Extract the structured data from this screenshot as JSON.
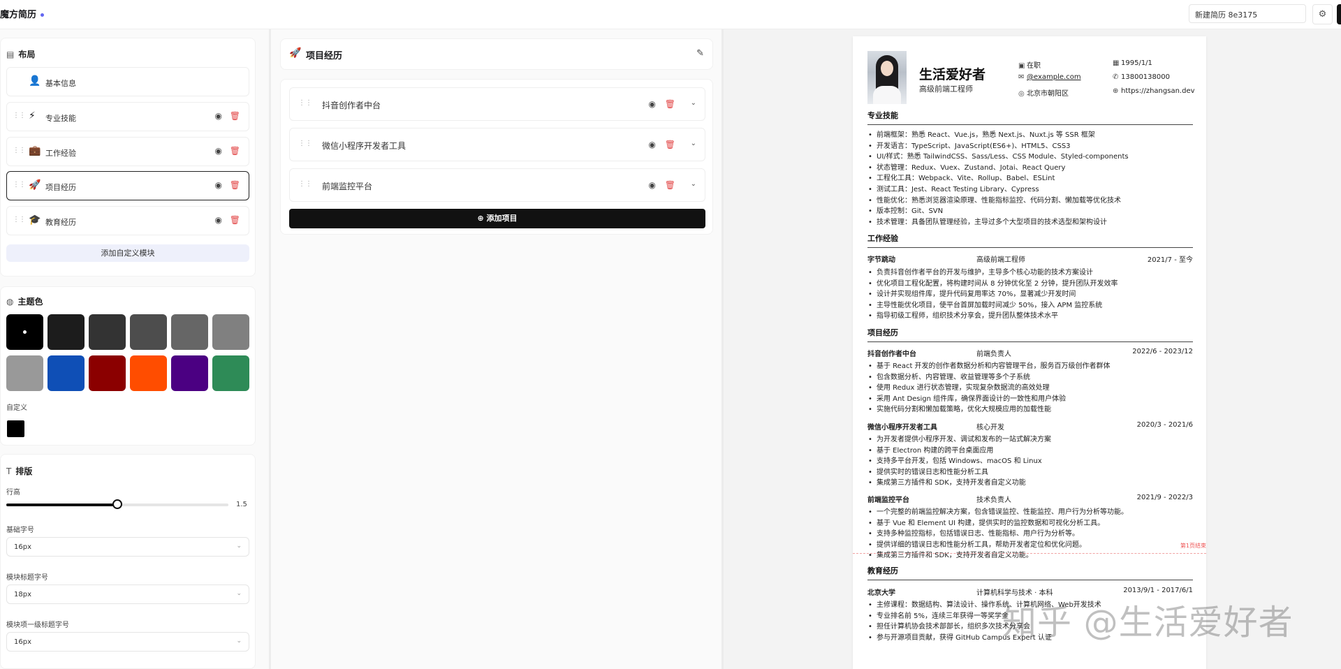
{
  "app": {
    "brand": "魔方简历",
    "resume_name": "新建简历 8e3175",
    "settings_icon": "gear-icon"
  },
  "layout": {
    "title": "布局",
    "items": [
      {
        "label": "基本信息",
        "icon": "👤"
      },
      {
        "label": "专业技能",
        "icon": "⚡"
      },
      {
        "label": "工作经验",
        "icon": "💼"
      },
      {
        "label": "项目经历",
        "icon": "🚀"
      },
      {
        "label": "教育经历",
        "icon": "🎓"
      }
    ],
    "add_custom": "添加自定义模块"
  },
  "theme": {
    "title": "主题色",
    "colors": [
      "#000000",
      "#1c1c1c",
      "#333333",
      "#4d4d4d",
      "#666666",
      "#808080",
      "#999999",
      "#0f4fb6",
      "#8b0000",
      "#ff4d00",
      "#4b0082",
      "#2e8b57"
    ],
    "selected": "#000000",
    "custom_label": "自定义",
    "custom_color": "#000000"
  },
  "typography": {
    "title": "排版",
    "line_height_label": "行高",
    "line_height_value": "1.5",
    "line_height_fraction": 0.5,
    "base_font_label": "基础字号",
    "base_font_value": "16px",
    "section_title_label": "模块标题字号",
    "section_title_value": "18px",
    "subtitle_label": "模块项一级标题字号",
    "subtitle_value": "16px"
  },
  "editor": {
    "title": "项目经历",
    "projects": [
      "抖音创作者中台",
      "微信小程序开发者工具",
      "前端监控平台"
    ],
    "add_label": "添加项目"
  },
  "resume": {
    "name": "生活爱好者",
    "title": "高级前端工程师",
    "status": "在职",
    "email": "@example.com",
    "location": "北京市朝阳区",
    "birth": "1995/1/1",
    "phone": "13800138000",
    "website": "https://zhangsan.dev",
    "skills_title": "专业技能",
    "skills": [
      "前端框架：熟悉 React、Vue.js，熟悉 Next.js、Nuxt.js 等 SSR 框架",
      "开发语言：TypeScript、JavaScript(ES6+)、HTML5、CSS3",
      "UI/样式：熟悉 TailwindCSS、Sass/Less、CSS Module、Styled-components",
      "状态管理：Redux、Vuex、Zustand、Jotai、React Query",
      "工程化工具：Webpack、Vite、Rollup、Babel、ESLint",
      "测试工具：Jest、React Testing Library、Cypress",
      "性能优化：熟悉浏览器渲染原理、性能指标监控、代码分割、懒加载等优化技术",
      "版本控制：Git、SVN",
      "技术管理：具备团队管理经验，主导过多个大型项目的技术选型和架构设计"
    ],
    "work_title": "工作经验",
    "work": {
      "company": "字节跳动",
      "role": "高级前端工程师",
      "date": "2021/7 - 至今",
      "bullets": [
        "负责抖音创作者平台的开发与维护，主导多个核心功能的技术方案设计",
        "优化项目工程化配置，将构建时间从 8 分钟优化至 2 分钟，提升团队开发效率",
        "设计并实现组件库，提升代码复用率达 70%，显著减少开发时间",
        "主导性能优化项目，使平台首屏加载时间减少 50%，接入 APM 监控系统",
        "指导初级工程师，组织技术分享会，提升团队整体技术水平"
      ]
    },
    "projects_title": "项目经历",
    "projects": [
      {
        "name": "抖音创作者中台",
        "role": "前端负责人",
        "date": "2022/6 - 2023/12",
        "bullets": [
          "基于 React 开发的创作者数据分析和内容管理平台，服务百万级创作者群体",
          "包含数据分析、内容管理、收益管理等多个子系统",
          "使用 Redux 进行状态管理，实现复杂数据流的高效处理",
          "采用 Ant Design 组件库，确保界面设计的一致性和用户体验",
          "实施代码分割和懒加载策略，优化大规模应用的加载性能"
        ]
      },
      {
        "name": "微信小程序开发者工具",
        "role": "核心开发",
        "date": "2020/3 - 2021/6",
        "bullets": [
          "为开发者提供小程序开发、调试和发布的一站式解决方案",
          "基于 Electron 构建的跨平台桌面应用",
          "支持多平台开发，包括 Windows、macOS 和 Linux",
          "提供实时的错误日志和性能分析工具",
          "集成第三方插件和 SDK，支持开发者自定义功能"
        ]
      },
      {
        "name": "前端监控平台",
        "role": "技术负责人",
        "date": "2021/9 - 2022/3",
        "bullets": [
          "一个完整的前端监控解决方案，包含错误监控、性能监控、用户行为分析等功能。",
          "基于 Vue 和 Element UI 构建，提供实时的监控数据和可视化分析工具。",
          "支持多种监控指标，包括错误日志、性能指标、用户行为分析等。",
          "提供详细的错误日志和性能分析工具，帮助开发者定位和优化问题。",
          "集成第三方插件和 SDK，支持开发者自定义功能。"
        ]
      }
    ],
    "page_end": "第1页结束",
    "edu_title": "教育经历",
    "edu": {
      "school": "北京大学",
      "major": "计算机科学与技术 · 本科",
      "date": "2013/9/1 - 2017/6/1",
      "bullets": [
        "主修课程：数据结构、算法设计、操作系统、计算机网络、Web开发技术",
        "专业排名前 5%，连续三年获得一等奖学金",
        "担任计算机协会技术部部长，组织多次技术分享会",
        "参与开源项目贡献，获得 GitHub Campus Expert 认证"
      ]
    }
  },
  "watermark": "知乎 @生活爱好者"
}
